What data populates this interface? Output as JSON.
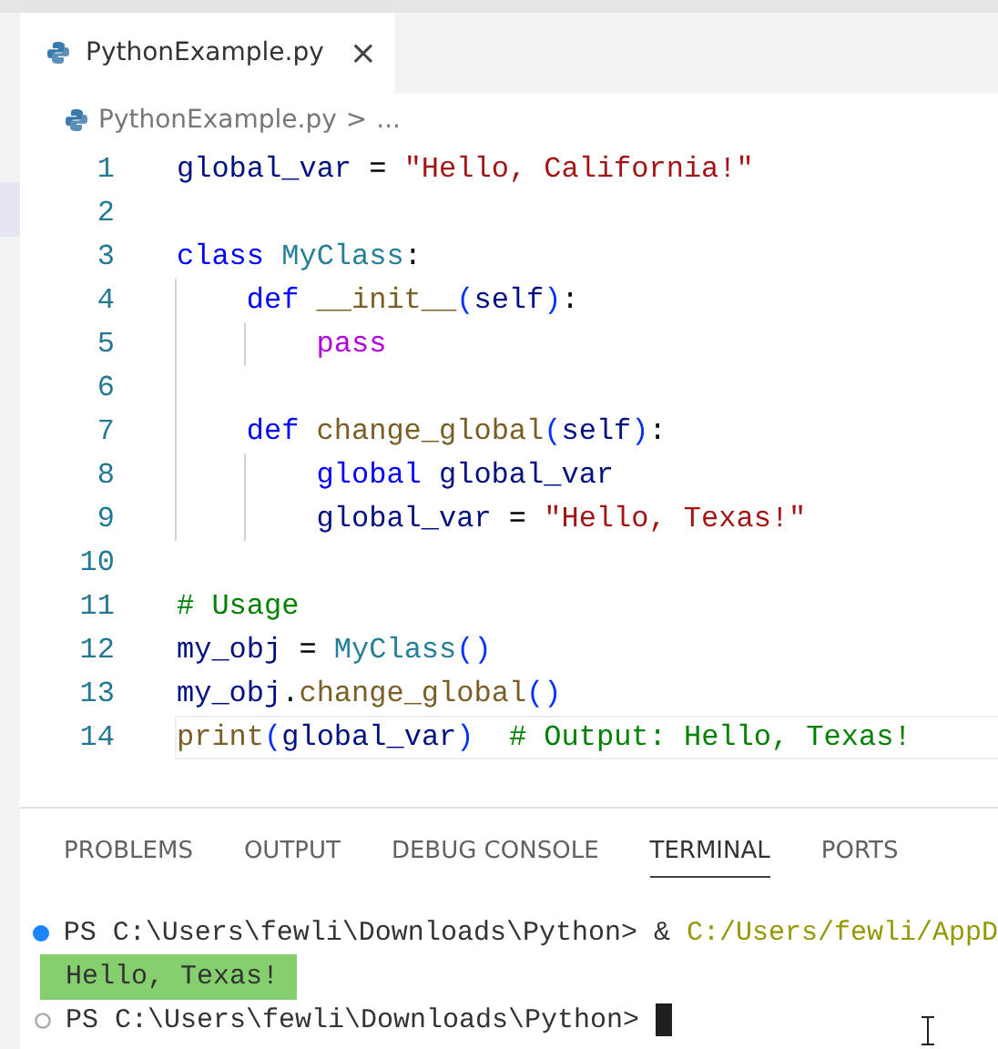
{
  "tabs": [
    {
      "label": "PythonExample.py",
      "selected": true,
      "close": "×"
    }
  ],
  "breadcrumb": {
    "file": "PythonExample.py",
    "separator": ">",
    "more": "..."
  },
  "code": [
    {
      "number": "1",
      "current": false,
      "tokens": [
        {
          "kind": "var",
          "text": "global_var"
        },
        {
          "kind": "plain",
          "text": " = "
        },
        {
          "kind": "str",
          "text": "\"Hello, California!\""
        }
      ]
    },
    {
      "number": "2",
      "current": false
    },
    {
      "number": "3",
      "current": false,
      "tokens": [
        {
          "kind": "kw",
          "text": "class "
        },
        {
          "kind": "cls",
          "text": "MyClass"
        },
        {
          "kind": "plain",
          "text": ":"
        }
      ],
      "children": [
        {
          "number": "4",
          "current": false,
          "tokens": [
            {
              "kind": "kw",
              "text": "def "
            },
            {
              "kind": "fn",
              "text": "__init__"
            },
            {
              "kind": "brace",
              "text": "("
            },
            {
              "kind": "var",
              "text": "self"
            },
            {
              "kind": "brace",
              "text": ")"
            },
            {
              "kind": "plain",
              "text": ":"
            }
          ],
          "children": [
            {
              "number": "5",
              "current": false,
              "tokens": [
                {
                  "kind": "ctrl",
                  "text": "pass"
                }
              ]
            }
          ]
        },
        {
          "number": "6",
          "current": false
        },
        {
          "number": "7",
          "current": false,
          "tokens": [
            {
              "kind": "kw",
              "text": "def "
            },
            {
              "kind": "fn",
              "text": "change_global"
            },
            {
              "kind": "brace",
              "text": "("
            },
            {
              "kind": "var",
              "text": "self"
            },
            {
              "kind": "brace",
              "text": ")"
            },
            {
              "kind": "plain",
              "text": ":"
            }
          ],
          "children": [
            {
              "number": "8",
              "current": false,
              "tokens": [
                {
                  "kind": "kw",
                  "text": "global "
                },
                {
                  "kind": "var",
                  "text": "global_var"
                }
              ]
            },
            {
              "number": "9",
              "current": false,
              "tokens": [
                {
                  "kind": "var",
                  "text": "global_var"
                },
                {
                  "kind": "plain",
                  "text": " = "
                },
                {
                  "kind": "str",
                  "text": "\"Hello, Texas!\""
                }
              ]
            }
          ]
        }
      ]
    },
    {
      "number": "10",
      "current": false
    },
    {
      "number": "11",
      "current": false,
      "tokens": [
        {
          "kind": "cmt",
          "text": "# Usage"
        }
      ]
    },
    {
      "number": "12",
      "current": false,
      "tokens": [
        {
          "kind": "var",
          "text": "my_obj"
        },
        {
          "kind": "plain",
          "text": " = "
        },
        {
          "kind": "cls",
          "text": "MyClass"
        },
        {
          "kind": "brace",
          "text": "()"
        }
      ]
    },
    {
      "number": "13",
      "current": false,
      "tokens": [
        {
          "kind": "var",
          "text": "my_obj"
        },
        {
          "kind": "plain",
          "text": "."
        },
        {
          "kind": "fn",
          "text": "change_global"
        },
        {
          "kind": "brace",
          "text": "()"
        }
      ]
    },
    {
      "number": "14",
      "current": true,
      "tokens": [
        {
          "kind": "fn",
          "text": "print"
        },
        {
          "kind": "brace",
          "text": "("
        },
        {
          "kind": "var",
          "text": "global_var"
        },
        {
          "kind": "brace",
          "text": ")  "
        },
        {
          "kind": "cmt",
          "text": "# Output: Hello, Texas!"
        }
      ]
    }
  ],
  "panel_tabs": [
    {
      "label": "PROBLEMS",
      "selected": false
    },
    {
      "label": "OUTPUT",
      "selected": false
    },
    {
      "label": "DEBUG CONSOLE",
      "selected": false
    },
    {
      "label": "TERMINAL",
      "selected": true
    },
    {
      "label": "PORTS",
      "selected": false
    }
  ],
  "terminal": [
    {
      "kind": "success",
      "highlighted": false,
      "cursor": false,
      "segments": [
        {
          "kind": "plain",
          "text": "PS C:\\Users\\fewli\\Downloads\\Python> & "
        },
        {
          "kind": "path",
          "text": "C:/Users/fewli/AppD"
        }
      ]
    },
    {
      "kind": "output",
      "highlighted": true,
      "cursor": false,
      "segments": [
        {
          "kind": "plain",
          "text": "Hello, Texas!"
        }
      ]
    },
    {
      "kind": "idle",
      "highlighted": false,
      "cursor": true,
      "segments": [
        {
          "kind": "plain",
          "text": "PS C:\\Users\\fewli\\Downloads\\Python> "
        }
      ]
    }
  ]
}
